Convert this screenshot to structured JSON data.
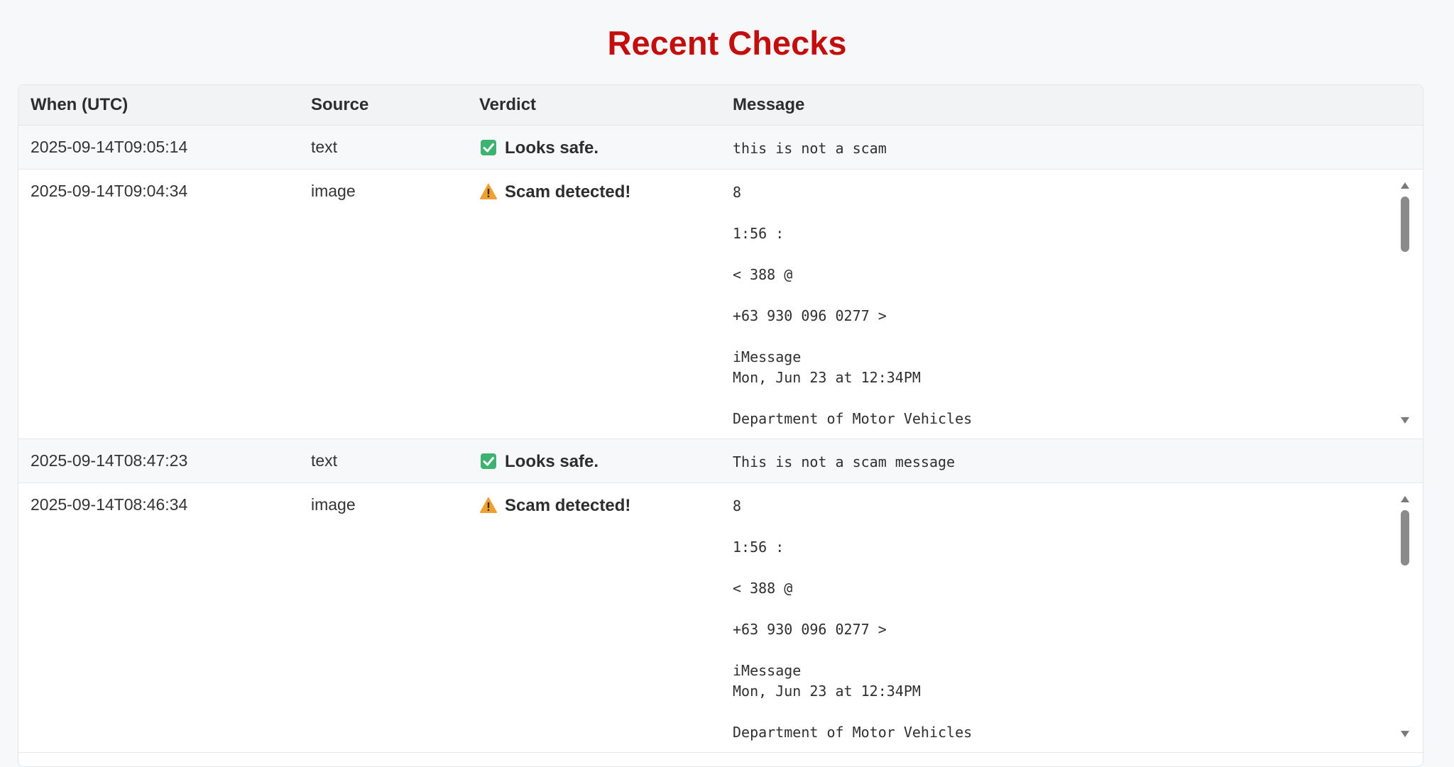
{
  "page": {
    "title": "Recent Checks"
  },
  "table": {
    "headers": [
      "When (UTC)",
      "Source",
      "Verdict",
      "Message"
    ],
    "rows": [
      {
        "when": "2025-09-14T09:05:14",
        "source": "text",
        "verdict": "Looks safe.",
        "verdict_icon": "check-mark-icon",
        "message_lines": [
          "this is not a scam"
        ]
      },
      {
        "when": "2025-09-14T09:04:34",
        "source": "image",
        "verdict": "Scam detected!",
        "verdict_icon": "warning-icon",
        "message_lines": [
          "8",
          "",
          "1:56 :",
          "",
          "< 388 @",
          "",
          "+63 930 096 0277 >",
          "",
          "iMessage",
          "Mon, Jun 23 at 12:34PM",
          "",
          "Department of Motor Vehicles"
        ]
      },
      {
        "when": "2025-09-14T08:47:23",
        "source": "text",
        "verdict": "Looks safe.",
        "verdict_icon": "check-mark-icon",
        "message_lines": [
          "This is not a scam message"
        ]
      },
      {
        "when": "2025-09-14T08:46:34",
        "source": "image",
        "verdict": "Scam detected!",
        "verdict_icon": "warning-icon",
        "message_lines": [
          "8",
          "",
          "1:56 :",
          "",
          "< 388 @",
          "",
          "+63 930 096 0277 >",
          "",
          "iMessage",
          "Mon, Jun 23 at 12:34PM",
          "",
          "Department of Motor Vehicles"
        ]
      }
    ]
  },
  "colors": {
    "title": "#c40d0d",
    "safe_icon": "#3cb371",
    "warning_icon": "#f0a030",
    "background": "#f7f8fa"
  }
}
